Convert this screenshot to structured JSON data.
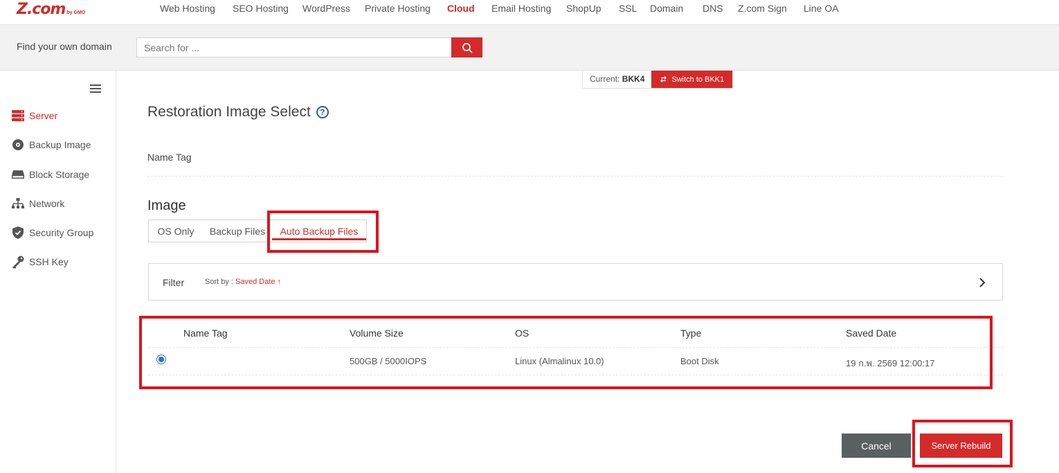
{
  "brand": {
    "logo_main": "Z.com",
    "logo_sub": "by GMO"
  },
  "nav": {
    "items": [
      {
        "label": "Web Hosting"
      },
      {
        "label": "SEO Hosting"
      },
      {
        "label": "WordPress"
      },
      {
        "label": "Private Hosting"
      },
      {
        "label": "Cloud"
      },
      {
        "label": "Email Hosting"
      },
      {
        "label": "ShopUp"
      },
      {
        "label": "SSL"
      },
      {
        "label": "Domain"
      },
      {
        "label": "DNS"
      },
      {
        "label": "Z.com Sign"
      },
      {
        "label": "Line OA"
      }
    ],
    "active": "Cloud"
  },
  "search": {
    "label": "Find your own domain",
    "placeholder": "Search for ..."
  },
  "sidebar": {
    "items": [
      {
        "label": "Server",
        "icon": "server-icon"
      },
      {
        "label": "Backup Image",
        "icon": "disc-icon"
      },
      {
        "label": "Block Storage",
        "icon": "storage-icon"
      },
      {
        "label": "Network",
        "icon": "network-icon"
      },
      {
        "label": "Security Group",
        "icon": "shield-icon"
      },
      {
        "label": "SSH Key",
        "icon": "key-icon"
      }
    ]
  },
  "region": {
    "current_label": "Current:",
    "current_value": "BKK4",
    "switch_label": "Switch to BKK1"
  },
  "page": {
    "title": "Restoration Image Select",
    "name_tag_label": "Name Tag",
    "image_heading": "Image"
  },
  "tabs": [
    {
      "label": "OS Only"
    },
    {
      "label": "Backup Files"
    },
    {
      "label": "Auto Backup Files"
    }
  ],
  "filter": {
    "label": "Filter",
    "sort_label": "Sort by :",
    "sort_value": "Saved Date ↑"
  },
  "table": {
    "headers": [
      "Name Tag",
      "Volume Size",
      "OS",
      "Type",
      "Saved Date"
    ],
    "rows": [
      {
        "selected": true,
        "name_tag": "",
        "volume_size": "500GB / 5000IOPS",
        "os": "Linux (Almalinux 10.0)",
        "type": "Boot Disk",
        "saved_date": "19 ก.พ. 2569 12:00:17"
      }
    ]
  },
  "buttons": {
    "cancel": "Cancel",
    "rebuild": "Server Rebuild"
  },
  "colors": {
    "accent": "#d42a2a",
    "cancel_bg": "#5a5f61",
    "highlight": "#e0121e",
    "radio": "#2a6fd6"
  }
}
